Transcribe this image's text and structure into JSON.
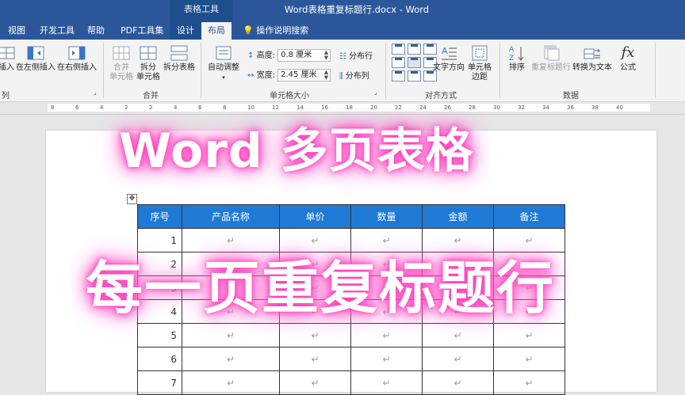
{
  "titlebar": {
    "context_tools": "表格工具",
    "document_title": "Word表格重复标题行.docx  -  Word"
  },
  "tabs": [
    {
      "label": "视图"
    },
    {
      "label": "开发工具"
    },
    {
      "label": "帮助"
    },
    {
      "label": "PDF工具集"
    },
    {
      "label": "设计"
    },
    {
      "label": "布局"
    }
  ],
  "tell_me": {
    "label": "操作说明搜索",
    "icon": "lightbulb-icon"
  },
  "ribbon": {
    "rows_cols": {
      "insert_partial": "插入",
      "insert_left": "在左侧插入",
      "insert_right": "在右侧插入",
      "group_label_partial": "列"
    },
    "merge": {
      "merge_cells_line1": "合并",
      "merge_cells_line2": "单元格",
      "split_cells_line1": "拆分",
      "split_cells_line2": "单元格",
      "split_table": "拆分表格",
      "group_label": "合并"
    },
    "cell_size": {
      "autofit": "自动调整",
      "height_label": "高度:",
      "height_value": "0.8 厘米",
      "width_label": "宽度:",
      "width_value": "2.45 厘米",
      "distribute_rows": "分布行",
      "distribute_cols": "分布列",
      "group_label": "单元格大小"
    },
    "alignment": {
      "text_direction": "文字方向",
      "cell_margins_line1": "单元格",
      "cell_margins_line2": "边距",
      "group_label": "对齐方式"
    },
    "data": {
      "sort": "排序",
      "repeat_header": "重复标题行",
      "convert_to_text": "转换为文本",
      "formula": "公式",
      "formula_icon_text": "fx",
      "group_label": "数据"
    }
  },
  "ruler": {
    "ticks": [
      "8",
      "6",
      "4",
      "2",
      "2",
      "4",
      "6",
      "8",
      "10",
      "12",
      "14",
      "16",
      "18",
      "20",
      "22",
      "24",
      "26",
      "28",
      "30",
      "32",
      "34",
      "36",
      "38",
      "40"
    ]
  },
  "table": {
    "headers": [
      "序号",
      "产品名称",
      "单价",
      "数量",
      "金额",
      "备注"
    ],
    "rows": [
      "1",
      "2",
      "3",
      "4",
      "5",
      "6",
      "7"
    ],
    "mark": "↵"
  },
  "overlay": {
    "line1": "Word 多页表格",
    "line2": "每一页重复标题行"
  },
  "colors": {
    "titlebar": "#2b579a",
    "table_header": "#1f7ad6",
    "glow": "#ff3dbb"
  }
}
